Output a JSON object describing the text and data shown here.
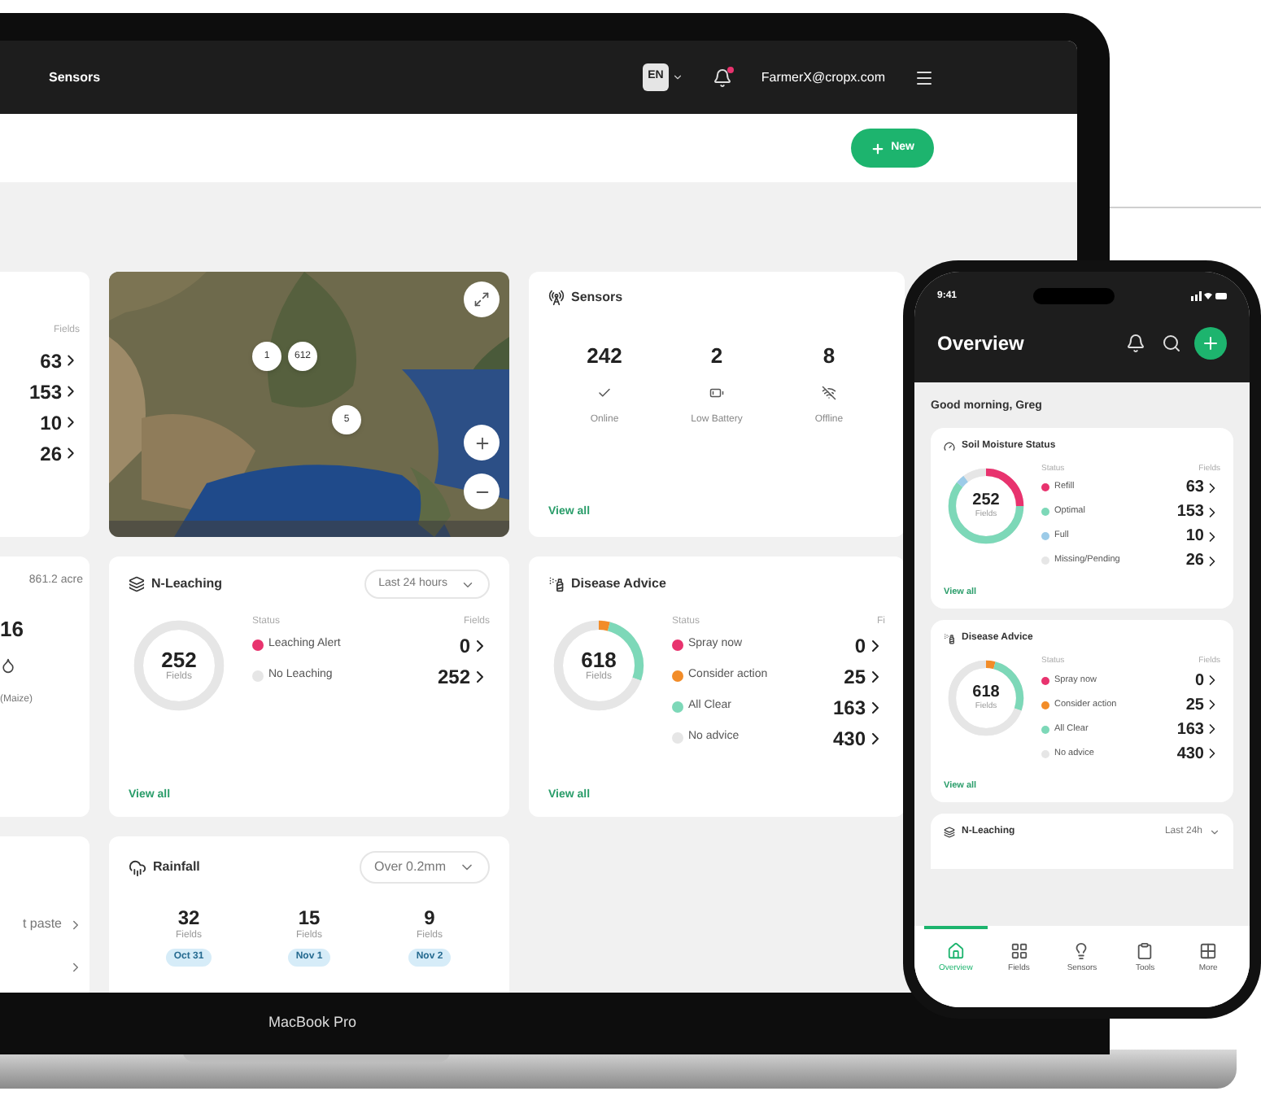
{
  "laptop": {
    "topbar": {
      "nav_item": "Sensors",
      "language": "EN",
      "notifications_unread": true,
      "user": "FarmerX@cropx.com"
    },
    "new_button": "New",
    "columns": [
      [
        {
          "kind": "partial_counts",
          "header": "Fields",
          "counts": [
            "63",
            "153",
            "10",
            "26"
          ]
        },
        {
          "kind": "partial_summary",
          "area": "861.2 acre",
          "value": "16",
          "crop": "(Maize)"
        },
        {
          "kind": "partial_links",
          "rows": [
            {
              "kind": "link",
              "label": "t paste"
            },
            {
              "kind": "chevron"
            }
          ]
        }
      ],
      [
        {
          "kind": "map",
          "clusters": [
            "1",
            "612",
            "5"
          ]
        },
        {
          "kind": "n_leaching",
          "title": "N-Leaching",
          "dropdown": "Last 24 hours",
          "total": "252",
          "unit": "Fields",
          "status_header": "Status",
          "count_header": "Fields",
          "rows": [
            {
              "label": "Leaching Alert",
              "count": "0",
              "color": "#e8336e"
            },
            {
              "label": "No Leaching",
              "count": "252",
              "color": "#e6e6e6"
            }
          ],
          "link": "View all"
        },
        {
          "kind": "rainfall",
          "title": "Rainfall",
          "dropdown": "Over 0.2mm",
          "stats": [
            {
              "value": "32",
              "unit": "Fields",
              "date": "Oct 31"
            },
            {
              "value": "15",
              "unit": "Fields",
              "date": "Nov 1"
            },
            {
              "value": "9",
              "unit": "Fields",
              "date": "Nov 2"
            }
          ]
        }
      ],
      [
        {
          "kind": "sensors",
          "title": "Sensors",
          "stats": [
            {
              "kind": "online",
              "value": "242",
              "label": "Online"
            },
            {
              "kind": "low_battery",
              "value": "2",
              "label": "Low Battery"
            },
            {
              "kind": "offline",
              "value": "8",
              "label": "Offline"
            }
          ],
          "link": "View all"
        },
        {
          "kind": "disease",
          "title": "Disease Advice",
          "total": "618",
          "unit": "Fields",
          "status_header": "Status",
          "count_header": "Fi",
          "rows": [
            {
              "label": "Spray now",
              "count": "0",
              "color": "#e8336e"
            },
            {
              "label": "Consider action",
              "count": "25",
              "color": "#f28c28"
            },
            {
              "label": "All Clear",
              "count": "163",
              "color": "#7dd8b8"
            },
            {
              "label": "No advice",
              "count": "430",
              "color": "#e6e6e6"
            }
          ],
          "link": "View all"
        }
      ]
    ],
    "label": "MacBook Pro"
  },
  "phone": {
    "time": "9:41",
    "title": "Overview",
    "greeting": "Good morning, Greg",
    "cards": [
      {
        "kind": "soil_moisture",
        "title": "Soil Moisture Status",
        "total": "252",
        "unit": "Fields",
        "status_header": "Status",
        "count_header": "Fields",
        "rows": [
          {
            "label": "Refill",
            "count": "63",
            "color": "#e8336e"
          },
          {
            "label": "Optimal",
            "count": "153",
            "color": "#7dd8b8"
          },
          {
            "label": "Full",
            "count": "10",
            "color": "#9ccbe8"
          },
          {
            "label": "Missing/Pending",
            "count": "26",
            "color": "#e6e6e6"
          }
        ],
        "link": "View all"
      },
      {
        "kind": "disease",
        "title": "Disease Advice",
        "total": "618",
        "unit": "Fields",
        "status_header": "Status",
        "count_header": "Fields",
        "rows": [
          {
            "label": "Spray now",
            "count": "0",
            "color": "#e8336e"
          },
          {
            "label": "Consider action",
            "count": "25",
            "color": "#f28c28"
          },
          {
            "label": "All Clear",
            "count": "163",
            "color": "#7dd8b8"
          },
          {
            "label": "No advice",
            "count": "430",
            "color": "#e6e6e6"
          }
        ],
        "link": "View all"
      },
      {
        "kind": "n_leaching",
        "title": "N-Leaching",
        "dropdown": "Last 24h"
      }
    ],
    "nav": [
      {
        "label": "Overview",
        "selected": true
      },
      {
        "label": "Fields",
        "selected": false
      },
      {
        "label": "Sensors",
        "selected": false
      },
      {
        "label": "Tools",
        "selected": false
      },
      {
        "label": "More",
        "selected": false
      }
    ]
  }
}
